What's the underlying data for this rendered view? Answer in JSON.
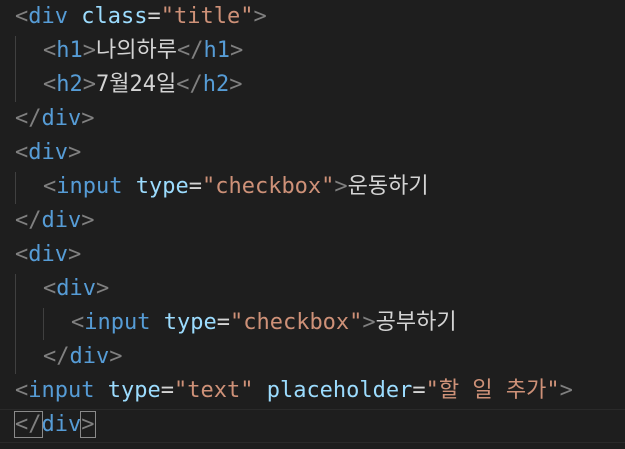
{
  "code_lines": [
    {
      "tokens": [
        [
          "<",
          "punct"
        ],
        [
          "div",
          "tag"
        ],
        [
          " ",
          "text"
        ],
        [
          "class",
          "attr"
        ],
        [
          "=",
          "text"
        ],
        [
          "\"title\"",
          "str"
        ],
        [
          ">",
          "punct"
        ]
      ]
    },
    {
      "tokens": [
        [
          "<",
          "punct"
        ],
        [
          "h1",
          "tag"
        ],
        [
          ">",
          "punct"
        ],
        [
          "나의하루",
          "text"
        ],
        [
          "</",
          "punct"
        ],
        [
          "h1",
          "tag"
        ],
        [
          ">",
          "punct"
        ]
      ]
    },
    {
      "tokens": [
        [
          "<",
          "punct"
        ],
        [
          "h2",
          "tag"
        ],
        [
          ">",
          "punct"
        ],
        [
          "7월24일",
          "text"
        ],
        [
          "</",
          "punct"
        ],
        [
          "h2",
          "tag"
        ],
        [
          ">",
          "punct"
        ]
      ]
    },
    {
      "tokens": [
        [
          "</",
          "punct"
        ],
        [
          "div",
          "tag"
        ],
        [
          ">",
          "punct"
        ]
      ]
    },
    {
      "tokens": [
        [
          "<",
          "punct"
        ],
        [
          "div",
          "tag"
        ],
        [
          ">",
          "punct"
        ]
      ]
    },
    {
      "tokens": [
        [
          "<",
          "punct"
        ],
        [
          "input",
          "tag"
        ],
        [
          " ",
          "text"
        ],
        [
          "type",
          "attr"
        ],
        [
          "=",
          "text"
        ],
        [
          "\"checkbox\"",
          "str"
        ],
        [
          ">",
          "punct"
        ],
        [
          "운동하기",
          "text"
        ]
      ]
    },
    {
      "tokens": [
        [
          "</",
          "punct"
        ],
        [
          "div",
          "tag"
        ],
        [
          ">",
          "punct"
        ]
      ]
    },
    {
      "tokens": [
        [
          "<",
          "punct"
        ],
        [
          "div",
          "tag"
        ],
        [
          ">",
          "punct"
        ]
      ]
    },
    {
      "tokens": [
        [
          "<",
          "punct"
        ],
        [
          "div",
          "tag"
        ],
        [
          ">",
          "punct"
        ]
      ]
    },
    {
      "tokens": [
        [
          "<",
          "punct"
        ],
        [
          "input",
          "tag"
        ],
        [
          " ",
          "text"
        ],
        [
          "type",
          "attr"
        ],
        [
          "=",
          "text"
        ],
        [
          "\"checkbox\"",
          "str"
        ],
        [
          ">",
          "punct"
        ],
        [
          "공부하기",
          "text"
        ]
      ]
    },
    {
      "tokens": [
        [
          "</",
          "punct"
        ],
        [
          "div",
          "tag"
        ],
        [
          ">",
          "punct"
        ]
      ]
    },
    {
      "tokens": [
        [
          "<",
          "punct"
        ],
        [
          "input",
          "tag"
        ],
        [
          " ",
          "text"
        ],
        [
          "type",
          "attr"
        ],
        [
          "=",
          "text"
        ],
        [
          "\"text\"",
          "str"
        ],
        [
          " ",
          "text"
        ],
        [
          "placeholder",
          "attr"
        ],
        [
          "=",
          "text"
        ],
        [
          "\"할 일 추가\"",
          "str"
        ],
        [
          ">",
          "punct"
        ]
      ]
    },
    {
      "tokens": [
        [
          "</",
          "punct"
        ],
        [
          "div",
          "tag"
        ],
        [
          ">",
          "punct"
        ]
      ]
    }
  ],
  "colors": {
    "background": "#1e1e1e",
    "punctuation": "#808080",
    "tag": "#569cd6",
    "attribute": "#9cdcfe",
    "string": "#ce9178",
    "text": "#d4d4d4"
  }
}
